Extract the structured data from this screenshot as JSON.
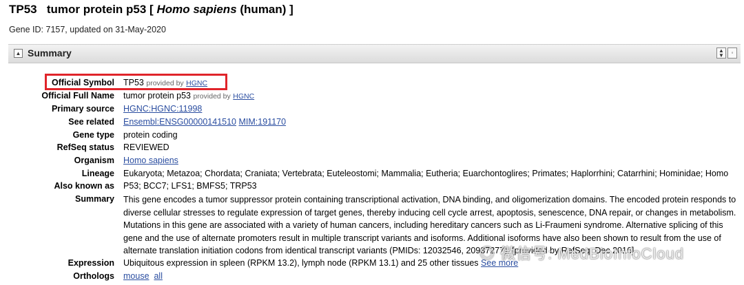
{
  "header": {
    "symbol": "TP53",
    "title_main": "tumor protein p53 [",
    "species": "Homo sapiens",
    "title_end": "(human) ]",
    "gene_id_line": "Gene ID: 7157, updated on 31-May-2020"
  },
  "summary_section": {
    "label": "Summary",
    "expand_icon": "minus-box-icon",
    "collapse_icon": "collapse-all-icon"
  },
  "fields": {
    "official_symbol": {
      "label": "Official Symbol",
      "value": "TP53",
      "provided": "provided by",
      "source": "HGNC"
    },
    "official_full_name": {
      "label": "Official Full Name",
      "value": "tumor protein p53",
      "provided": "provided by",
      "source": "HGNC"
    },
    "primary_source": {
      "label": "Primary source",
      "link": "HGNC:HGNC:11998"
    },
    "see_related": {
      "label": "See related",
      "link1": "Ensembl:ENSG00000141510",
      "link2": "MIM:191170"
    },
    "gene_type": {
      "label": "Gene type",
      "value": "protein coding"
    },
    "refseq_status": {
      "label": "RefSeq status",
      "value": "REVIEWED"
    },
    "organism": {
      "label": "Organism",
      "link": "Homo sapiens"
    },
    "lineage": {
      "label": "Lineage",
      "value": "Eukaryota; Metazoa; Chordata; Craniata; Vertebrata; Euteleostomi; Mammalia; Eutheria; Euarchontoglires; Primates; Haplorrhini; Catarrhini; Hominidae; Homo"
    },
    "also_known_as": {
      "label": "Also known as",
      "value": "P53; BCC7; LFS1; BMFS5; TRP53"
    },
    "summary": {
      "label": "Summary",
      "value": "This gene encodes a tumor suppressor protein containing transcriptional activation, DNA binding, and oligomerization domains. The encoded protein responds to diverse cellular stresses to regulate expression of target genes, thereby inducing cell cycle arrest, apoptosis, senescence, DNA repair, or changes in metabolism. Mutations in this gene are associated with a variety of human cancers, including hereditary cancers such as Li-Fraumeni syndrome. Alternative splicing of this gene and the use of alternate promoters result in multiple transcript variants and isoforms. Additional isoforms have also been shown to result from the use of alternate translation initiation codons from identical transcript variants (PMIDs: 12032546, 20937277). [provided by RefSeq, Dec 2016]"
    },
    "expression": {
      "label": "Expression",
      "value": "Ubiquitous expression in spleen (RPKM 13.2), lymph node (RPKM 13.1) and 25 other tissues",
      "link": "See more"
    },
    "orthologs": {
      "label": "Orthologs",
      "link1": "mouse",
      "link2": "all"
    }
  },
  "watermark": {
    "text": "微信号: MedBioInfoCloud"
  },
  "colors": {
    "link": "#2a4da0",
    "highlight": "#e0242a"
  }
}
